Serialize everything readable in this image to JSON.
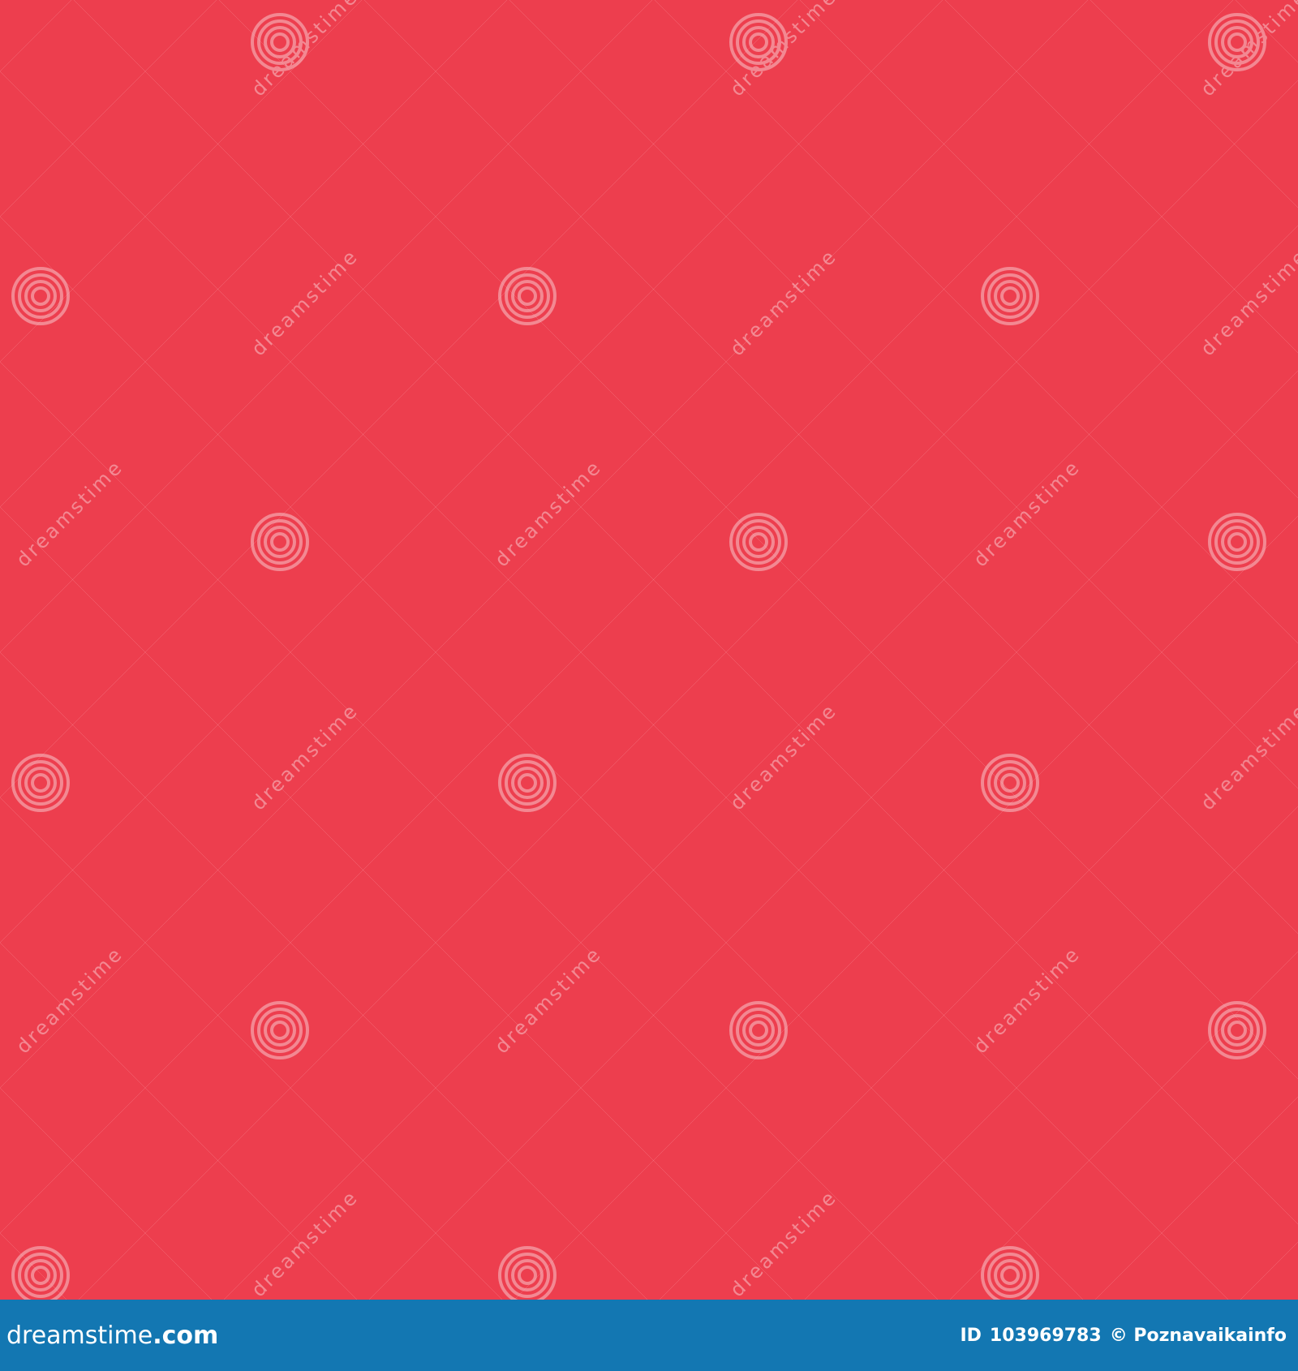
{
  "colors": {
    "diamond_red": "#ED3E4E",
    "diamond_white": "#FFFFFF",
    "footer_bar": "#1377B2",
    "watermark": "#F7C5CB"
  },
  "pattern": {
    "type": "diagonal-checkerboard",
    "orientation": "45-degree diamonds"
  },
  "watermark": {
    "text": "dreamstime",
    "icon": "spiral-logo-icon"
  },
  "footer": {
    "brand_name": "dreamstime",
    "brand_suffix": ".com",
    "id_label": "ID",
    "id_number": "103969783",
    "credit": "© Poznavaikainfo"
  }
}
